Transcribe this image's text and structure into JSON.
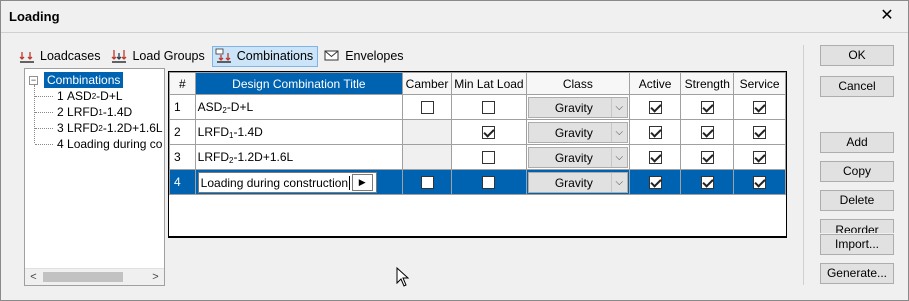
{
  "window": {
    "title": "Loading",
    "close_glyph": "✕"
  },
  "toolbar": [
    {
      "label": "Loadcases",
      "icon": "loadcases-icon",
      "active": false
    },
    {
      "label": "Load Groups",
      "icon": "load-groups-icon",
      "active": false
    },
    {
      "label": "Combinations",
      "icon": "combinations-icon",
      "active": true
    },
    {
      "label": "Envelopes",
      "icon": "envelopes-icon",
      "active": false
    }
  ],
  "tree": {
    "root_label": "Combinations",
    "expander_glyph": "−",
    "items": [
      {
        "num": "1",
        "pre": "ASD",
        "sub": "2",
        "post": "-D+L"
      },
      {
        "num": "2",
        "pre": "LRFD",
        "sub": "1",
        "post": "-1.4D"
      },
      {
        "num": "3",
        "pre": "LRFD",
        "sub": "2",
        "post": "-1.2D+1.6L"
      },
      {
        "num": "4",
        "pre": "Loading during co",
        "sub": "",
        "post": ""
      }
    ],
    "scroll_left_glyph": "<",
    "scroll_right_glyph": ">"
  },
  "grid": {
    "columns": [
      "#",
      "Design Combination Title",
      "Camber",
      "Min Lat Load",
      "Class",
      "Active",
      "Strength",
      "Service"
    ],
    "rows": [
      {
        "num": "1",
        "title_pre": "ASD",
        "title_sub": "2",
        "title_post": "-D+L",
        "camber": false,
        "camber_enabled": true,
        "min_lat": false,
        "class": "Gravity",
        "active": true,
        "strength": true,
        "service": true
      },
      {
        "num": "2",
        "title_pre": "LRFD",
        "title_sub": "1",
        "title_post": "-1.4D",
        "camber": false,
        "camber_enabled": false,
        "min_lat": true,
        "class": "Gravity",
        "active": true,
        "strength": true,
        "service": true
      },
      {
        "num": "3",
        "title_pre": "LRFD",
        "title_sub": "2",
        "title_post": "-1.2D+1.6L",
        "camber": false,
        "camber_enabled": false,
        "min_lat": false,
        "class": "Gravity",
        "active": true,
        "strength": true,
        "service": true
      },
      {
        "num": "4",
        "title_pre": "Loading during construction",
        "title_sub": "",
        "title_post": "",
        "camber": false,
        "camber_enabled": true,
        "min_lat": false,
        "class": "Gravity",
        "active": true,
        "strength": true,
        "service": true,
        "editing": true
      }
    ],
    "combo_arrow_glyph": "⌵",
    "edit_button_glyph": "▶"
  },
  "buttons": {
    "ok": "OK",
    "cancel": "Cancel",
    "add": "Add",
    "copy": "Copy",
    "delete": "Delete",
    "reorder": "Reorder",
    "import": "Import...",
    "generate": "Generate..."
  },
  "colors": {
    "selection": "#0063b1",
    "active_tab_bg": "#cce4f7"
  }
}
